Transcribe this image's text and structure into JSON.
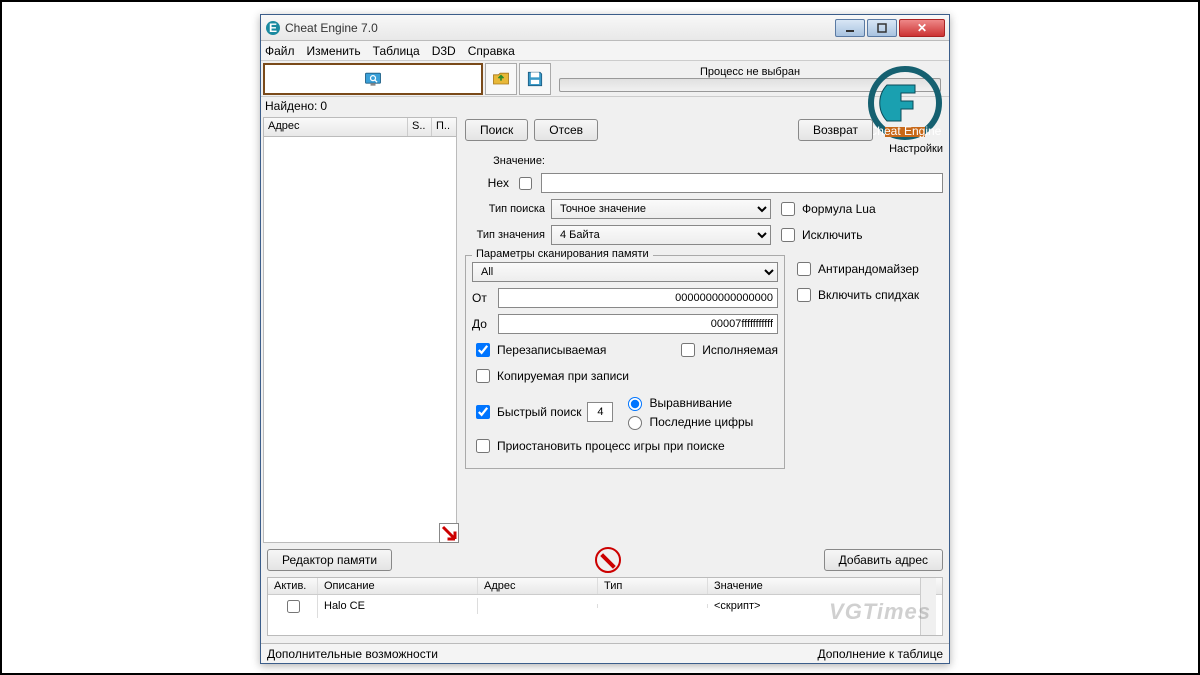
{
  "window": {
    "title": "Cheat Engine 7.0"
  },
  "menu": {
    "file": "Файл",
    "edit": "Изменить",
    "table": "Таблица",
    "d3d": "D3D",
    "help": "Справка"
  },
  "toolbar": {
    "process_label": "Процесс не выбран"
  },
  "found": {
    "label": "Найдено:",
    "value": "0"
  },
  "settings_label": "Настройки",
  "left_headers": {
    "address": "Адрес",
    "s": "S..",
    "p": "П.."
  },
  "buttons": {
    "search": "Поиск",
    "filter": "Отсев",
    "revert": "Возврат",
    "mem_editor": "Редактор памяти",
    "add_addr": "Добавить адрес"
  },
  "labels": {
    "value": "Значение:",
    "hex": "Hex",
    "search_type": "Тип поиска",
    "value_type": "Тип значения",
    "scan_params": "Параметры сканирования памяти",
    "from": "От",
    "to": "До",
    "writable": "Перезаписываемая",
    "executable": "Исполняемая",
    "cow": "Копируемая при записи",
    "fast": "Быстрый поиск",
    "align": "Выравнивание",
    "last_digits": "Последние цифры",
    "pause": "Приостановить процесс игры при поиске",
    "lua": "Формула Lua",
    "exclude": "Исключить",
    "antirand": "Антирандомайзер",
    "speedhack": "Включить спидхак"
  },
  "values": {
    "search_type": "Точное значение",
    "value_type": "4 Байта",
    "region": "All",
    "from": "0000000000000000",
    "to": "00007fffffffffff",
    "fast_val": "4"
  },
  "table": {
    "headers": {
      "active": "Актив.",
      "desc": "Описание",
      "addr": "Адрес",
      "type": "Тип",
      "value": "Значение"
    },
    "rows": [
      {
        "active": false,
        "desc": "Halo CE",
        "addr": "",
        "type": "",
        "value": "<скрипт>"
      }
    ]
  },
  "status": {
    "left": "Дополнительные возможности",
    "right": "Дополнение к таблице"
  },
  "watermark": "VGTimes"
}
